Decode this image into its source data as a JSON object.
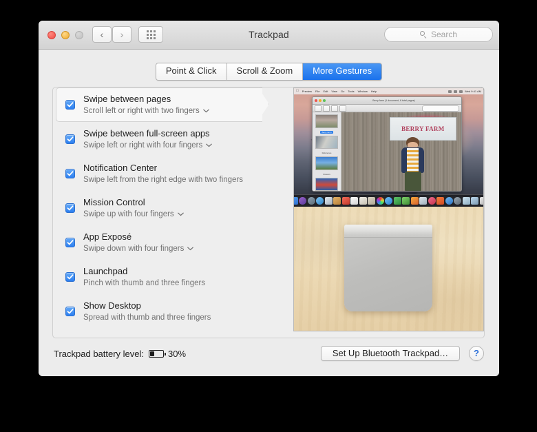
{
  "window": {
    "title": "Trackpad",
    "traffic_lights": {
      "close": "close-button",
      "minimize": "minimize-button",
      "zoom": "zoom-button"
    },
    "nav": {
      "back": "‹",
      "forward": "›"
    },
    "grid_button": "show-all-preferences",
    "search": {
      "placeholder": "Search",
      "value": ""
    }
  },
  "tabs": [
    {
      "label": "Point & Click",
      "active": false
    },
    {
      "label": "Scroll & Zoom",
      "active": false
    },
    {
      "label": "More Gestures",
      "active": true
    }
  ],
  "gestures": [
    {
      "title": "Swipe between pages",
      "subtitle": "Scroll left or right with two fingers",
      "has_dropdown": true,
      "checked": true,
      "selected": true
    },
    {
      "title": "Swipe between full-screen apps",
      "subtitle": "Swipe left or right with four fingers",
      "has_dropdown": true,
      "checked": true,
      "selected": false
    },
    {
      "title": "Notification Center",
      "subtitle": "Swipe left from the right edge with two fingers",
      "has_dropdown": false,
      "checked": true,
      "selected": false
    },
    {
      "title": "Mission Control",
      "subtitle": "Swipe up with four fingers",
      "has_dropdown": true,
      "checked": true,
      "selected": false
    },
    {
      "title": "App Exposé",
      "subtitle": "Swipe down with four fingers",
      "has_dropdown": true,
      "checked": true,
      "selected": false
    },
    {
      "title": "Launchpad",
      "subtitle": "Pinch with thumb and three fingers",
      "has_dropdown": false,
      "checked": true,
      "selected": false
    },
    {
      "title": "Show Desktop",
      "subtitle": "Spread with thumb and three fingers",
      "has_dropdown": false,
      "checked": true,
      "selected": false
    }
  ],
  "preview": {
    "desktop": {
      "menubar_apps": [
        "Preview",
        "File",
        "Edit",
        "View",
        "Go",
        "Tools",
        "Window",
        "Help"
      ],
      "menubar_clock": "Wed 9:41 AM",
      "preview_window_title": "Berry farm (1 document, 6 total pages)",
      "sidebar_thumbnails": [
        {
          "label": "Berry farm",
          "selected": true
        },
        {
          "label": "Reference",
          "selected": false
        },
        {
          "label": "Flowers",
          "selected": false
        },
        {
          "label": "",
          "selected": false
        }
      ],
      "photo_sign_text": "BERRY FARM",
      "search_placeholder": "Search"
    },
    "trackpad_device": "Magic Trackpad on wood surface"
  },
  "bottom": {
    "battery_label": "Trackpad battery level:",
    "battery_percent": "30%",
    "battery_fill_ratio": 30,
    "setup_button": "Set Up Bluetooth Trackpad…",
    "help_button": "?"
  },
  "colors": {
    "accent_blue": "#2c7ff0",
    "tab_active_bg": "#1a72ec",
    "help_blue": "#2b6fd8",
    "window_bg": "#ececec",
    "panel_bg": "#eeeeee",
    "selected_row_bg": "#f7f7f7"
  },
  "icons": {
    "search": "search-icon",
    "chevron_down": "⌄",
    "back": "chevron-left-icon",
    "forward": "chevron-right-icon"
  }
}
